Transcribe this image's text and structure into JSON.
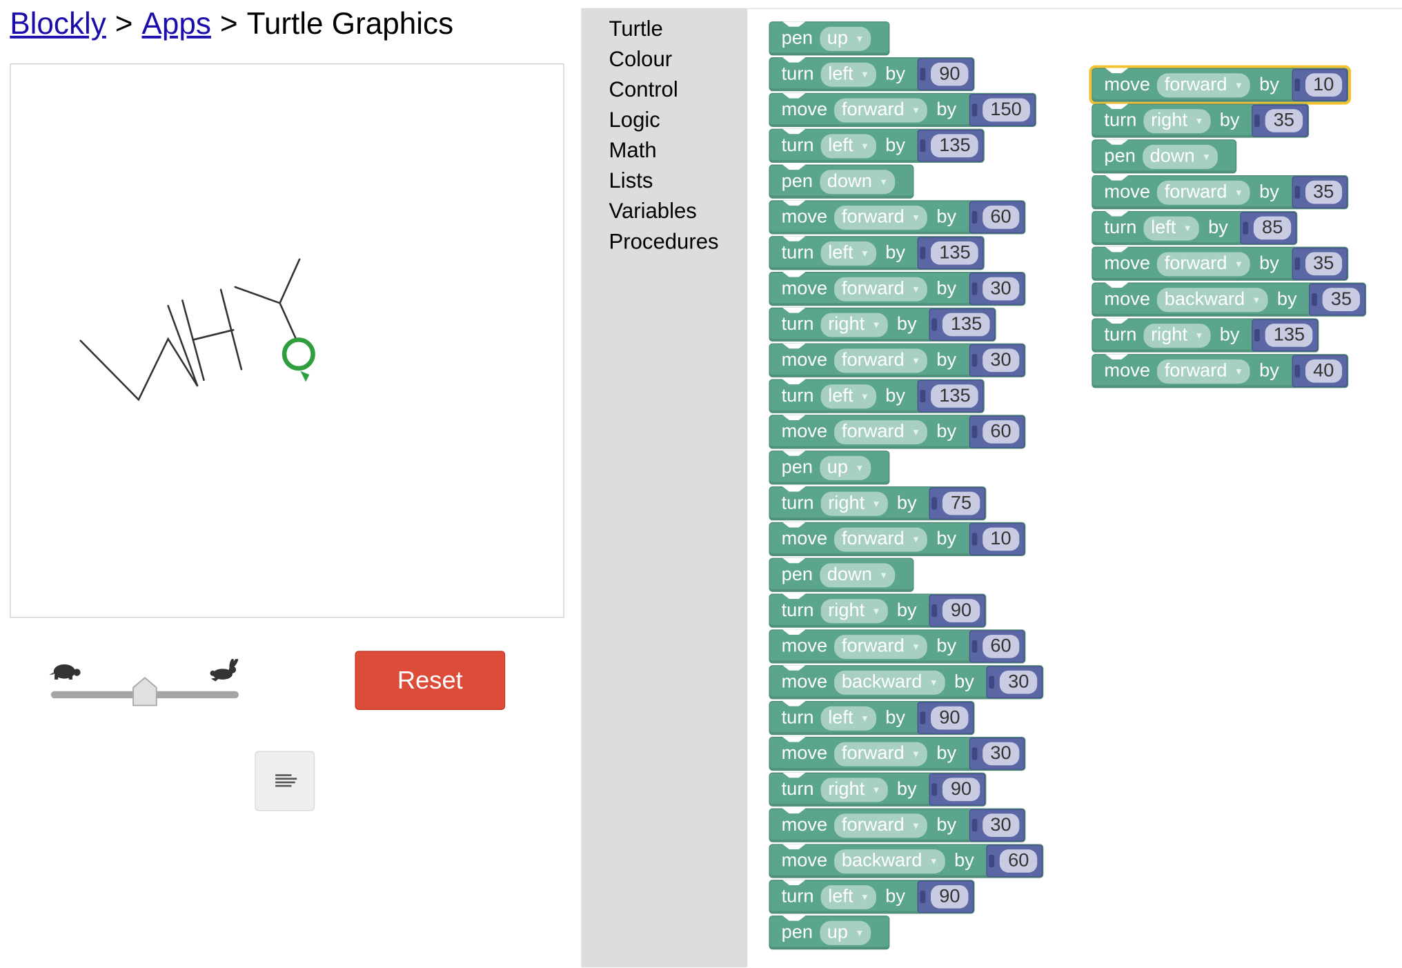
{
  "breadcrumb": {
    "blockly": "Blockly",
    "apps": "Apps",
    "sep1": ">",
    "sep2": ">",
    "title": "Turtle Graphics"
  },
  "controls": {
    "reset_label": "Reset",
    "speed_slider": {
      "value": 0.5,
      "slow_icon": "turtle-icon",
      "fast_icon": "rabbit-icon"
    },
    "code_button_icon": "code-icon"
  },
  "toolbox": {
    "categories": [
      "Turtle",
      "Colour",
      "Control",
      "Logic",
      "Math",
      "Lists",
      "Variables",
      "Procedures"
    ]
  },
  "colors": {
    "turtle_block": "#5ba58c",
    "number_block": "#5b67a5",
    "reset": "#dd4b39",
    "turtle_marker": "#2e9e3e",
    "selection": "#f2c230"
  },
  "workspace": {
    "stack1": [
      {
        "kind": "pen",
        "word": "pen",
        "option": "up"
      },
      {
        "kind": "turn",
        "word": "turn",
        "option": "left",
        "by": "by",
        "value": "90"
      },
      {
        "kind": "move",
        "word": "move",
        "option": "forward",
        "by": "by",
        "value": "150"
      },
      {
        "kind": "turn",
        "word": "turn",
        "option": "left",
        "by": "by",
        "value": "135"
      },
      {
        "kind": "pen",
        "word": "pen",
        "option": "down"
      },
      {
        "kind": "move",
        "word": "move",
        "option": "forward",
        "by": "by",
        "value": "60"
      },
      {
        "kind": "turn",
        "word": "turn",
        "option": "left",
        "by": "by",
        "value": "135"
      },
      {
        "kind": "move",
        "word": "move",
        "option": "forward",
        "by": "by",
        "value": "30"
      },
      {
        "kind": "turn",
        "word": "turn",
        "option": "right",
        "by": "by",
        "value": "135"
      },
      {
        "kind": "move",
        "word": "move",
        "option": "forward",
        "by": "by",
        "value": "30"
      },
      {
        "kind": "turn",
        "word": "turn",
        "option": "left",
        "by": "by",
        "value": "135"
      },
      {
        "kind": "move",
        "word": "move",
        "option": "forward",
        "by": "by",
        "value": "60"
      },
      {
        "kind": "pen",
        "word": "pen",
        "option": "up"
      },
      {
        "kind": "turn",
        "word": "turn",
        "option": "right",
        "by": "by",
        "value": "75"
      },
      {
        "kind": "move",
        "word": "move",
        "option": "forward",
        "by": "by",
        "value": "10"
      },
      {
        "kind": "pen",
        "word": "pen",
        "option": "down"
      },
      {
        "kind": "turn",
        "word": "turn",
        "option": "right",
        "by": "by",
        "value": "90"
      },
      {
        "kind": "move",
        "word": "move",
        "option": "forward",
        "by": "by",
        "value": "60"
      },
      {
        "kind": "move",
        "word": "move",
        "option": "backward",
        "by": "by",
        "value": "30"
      },
      {
        "kind": "turn",
        "word": "turn",
        "option": "left",
        "by": "by",
        "value": "90"
      },
      {
        "kind": "move",
        "word": "move",
        "option": "forward",
        "by": "by",
        "value": "30"
      },
      {
        "kind": "turn",
        "word": "turn",
        "option": "right",
        "by": "by",
        "value": "90"
      },
      {
        "kind": "move",
        "word": "move",
        "option": "forward",
        "by": "by",
        "value": "30"
      },
      {
        "kind": "move",
        "word": "move",
        "option": "backward",
        "by": "by",
        "value": "60"
      },
      {
        "kind": "turn",
        "word": "turn",
        "option": "left",
        "by": "by",
        "value": "90"
      },
      {
        "kind": "pen",
        "word": "pen",
        "option": "up"
      }
    ],
    "stack2": [
      {
        "kind": "move",
        "word": "move",
        "option": "forward",
        "by": "by",
        "value": "10",
        "selected": true
      },
      {
        "kind": "turn",
        "word": "turn",
        "option": "right",
        "by": "by",
        "value": "35"
      },
      {
        "kind": "pen",
        "word": "pen",
        "option": "down"
      },
      {
        "kind": "move",
        "word": "move",
        "option": "forward",
        "by": "by",
        "value": "35"
      },
      {
        "kind": "turn",
        "word": "turn",
        "option": "left",
        "by": "by",
        "value": "85"
      },
      {
        "kind": "move",
        "word": "move",
        "option": "forward",
        "by": "by",
        "value": "35"
      },
      {
        "kind": "move",
        "word": "move",
        "option": "backward",
        "by": "by",
        "value": "35"
      },
      {
        "kind": "turn",
        "word": "turn",
        "option": "right",
        "by": "by",
        "value": "135"
      },
      {
        "kind": "move",
        "word": "move",
        "option": "forward",
        "by": "by",
        "value": "40"
      }
    ]
  }
}
